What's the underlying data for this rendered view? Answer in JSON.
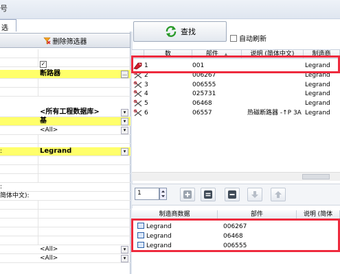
{
  "title_fragment": "号",
  "filter_tab": "选",
  "delete_filter_label": "删除筛选器",
  "search_label": "查找",
  "auto_refresh_label": "自动刷新",
  "left": {
    "checkbox_mark": "✓",
    "ellipsis": "...",
    "dropdown_arrow": "▾",
    "values": {
      "category": "断路器",
      "database": "<所有工程数据库>",
      "base": "基",
      "all1": "<All>",
      "manufacturer": "Legrand",
      "all2": "<All>",
      "all3": "<All>"
    },
    "labels": {
      "manufacturer_colon": ":",
      "desc_colon": ":",
      "desc_cn": "简体中文):"
    }
  },
  "upper_table": {
    "headers": [
      "数",
      "部件",
      "说明 (简体中文)",
      "制造商"
    ],
    "sort_arrow": "▲",
    "rows": [
      {
        "num": "1",
        "part": "001",
        "desc": "",
        "mfr": "Legrand"
      },
      {
        "num": "2",
        "part": "006267",
        "desc": "",
        "mfr": "Legrand"
      },
      {
        "num": "3",
        "part": "006555",
        "desc": "",
        "mfr": "Legrand"
      },
      {
        "num": "4",
        "part": "025731",
        "desc": "",
        "mfr": "Legrand"
      },
      {
        "num": "5",
        "part": "06468",
        "desc": "",
        "mfr": "Legrand"
      },
      {
        "num": "6",
        "part": "06557",
        "desc": "热磁断路器 -↑P 3A",
        "mfr": "Legrand"
      }
    ]
  },
  "qty_value": "1",
  "toolbar_icons": [
    "add-icon",
    "equals-icon",
    "minus-icon",
    "arrow-down-icon",
    "arrow-up-icon"
  ],
  "lower_table": {
    "headers": [
      "制造商数据",
      "部件",
      "说明 (简体"
    ],
    "rows": [
      {
        "mfr": "Legrand",
        "part": "006267"
      },
      {
        "mfr": "Legrand",
        "part": "06468"
      },
      {
        "mfr": "Legrand",
        "part": "006555"
      }
    ]
  },
  "colors": {
    "highlight": "#ffff6a",
    "callout": "#ee2a3d"
  }
}
